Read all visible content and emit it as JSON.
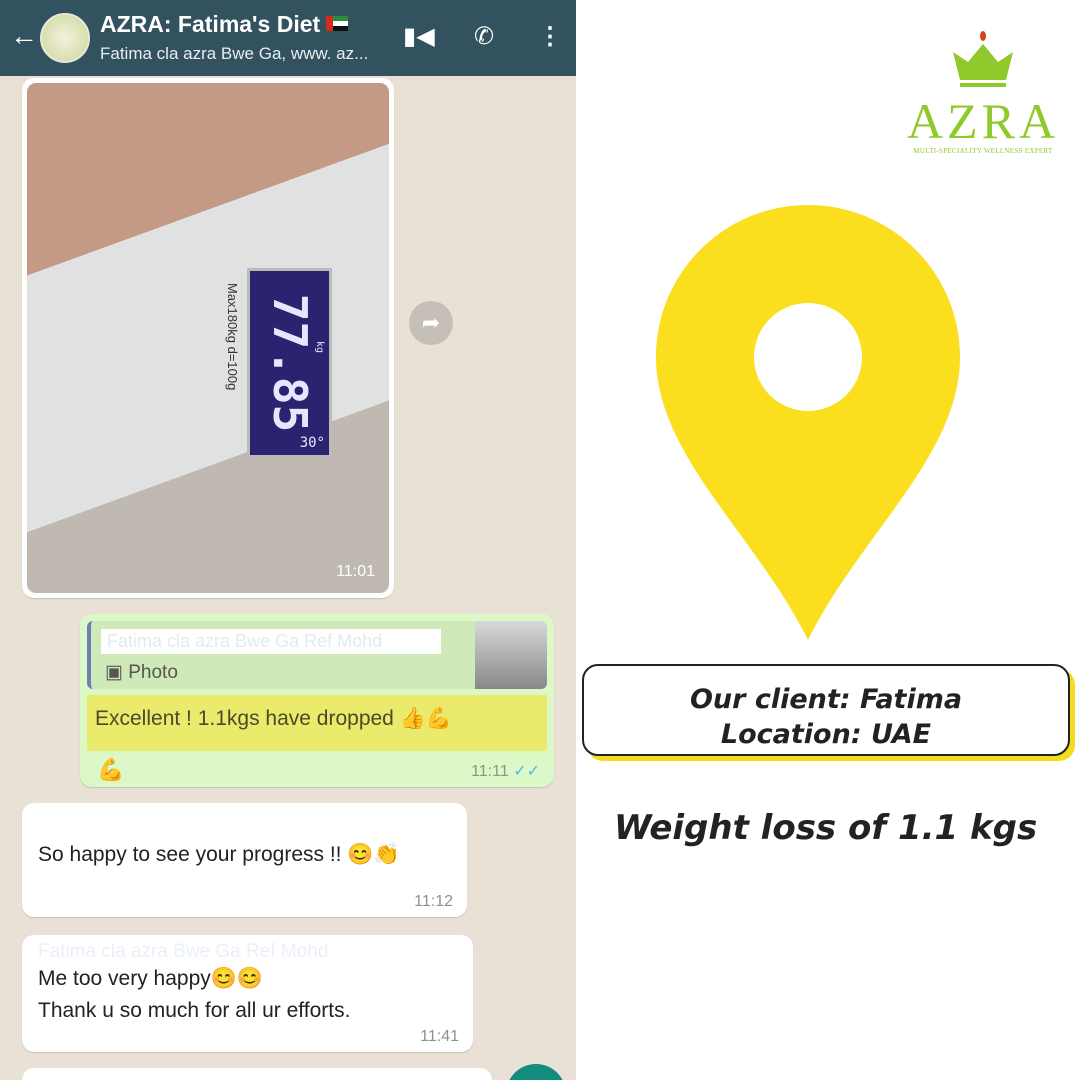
{
  "header": {
    "back": "←",
    "title": "AZRA: Fatima's Diet",
    "subtitle": "Fatima cla azra Bwe Ga, www. az...",
    "video": "▮◀",
    "call": "✆",
    "menu": "⋮"
  },
  "messages": {
    "photo": {
      "scale_reading": "77.85",
      "unit": "kg",
      "temp": "30°",
      "scale_label": "Max180kg d=100g",
      "time": "11:01",
      "forward": "➦"
    },
    "reply": {
      "quoted_name": "Fatima cla azra Bwe Ga Ref Mohd",
      "quoted_type": "Photo",
      "text": "Excellent ! 1.1kgs have dropped 👍💪",
      "extra": "💪",
      "time": "11:11",
      "ticks": "✓✓"
    },
    "m1": {
      "text": "So happy to see your progress !! 😊👏",
      "time": "11:12"
    },
    "m2": {
      "sender": "Fatima cla azra Bwe Ga Ref Mohd",
      "line1": "Me too very happy😊😊",
      "line2": "Thank u so much for all ur efforts.",
      "time": "11:41"
    }
  },
  "brand": {
    "name": "AZRA",
    "tagline": "MULTI-SPECIALITY WELLNESS EXPERT",
    "color": "#8fc92c"
  },
  "info": {
    "client": "Our client: Fatima",
    "location": "Location: UAE",
    "result": "Weight loss of 1.1 kgs",
    "pin_color": "#fbdf1e"
  }
}
